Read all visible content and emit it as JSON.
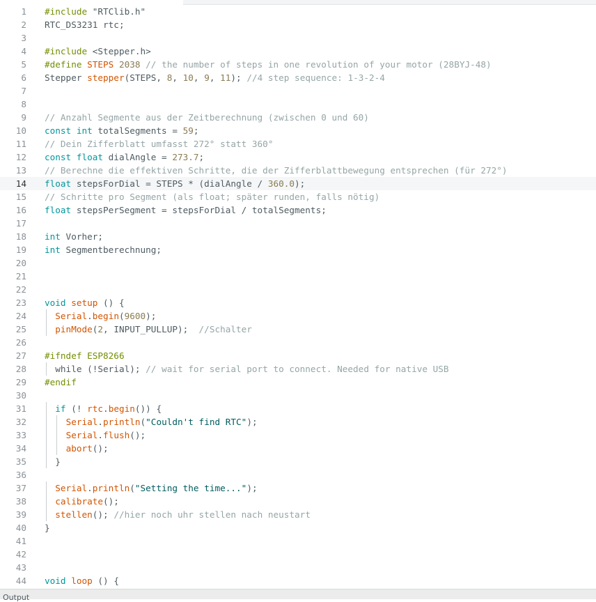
{
  "editor": {
    "current_line": 14,
    "colors": {
      "directive": "#728e00",
      "keyword": "#00979d",
      "function": "#d35400",
      "number": "#8a7b52",
      "string": "#005c5f",
      "comment": "#95a5a6",
      "text": "#4e5b61",
      "current_line_background": "#f5f6f7"
    },
    "lines": [
      {
        "n": "1",
        "tokens": [
          [
            "dir",
            "#include "
          ],
          [
            "txt",
            "\"RTClib.h\""
          ]
        ]
      },
      {
        "n": "2",
        "tokens": [
          [
            "txt",
            "RTC_DS3231 rtc;"
          ]
        ]
      },
      {
        "n": "3",
        "tokens": []
      },
      {
        "n": "4",
        "tokens": [
          [
            "dir",
            "#include "
          ],
          [
            "txt",
            "<Stepper.h>"
          ]
        ]
      },
      {
        "n": "5",
        "tokens": [
          [
            "dir",
            "#define "
          ],
          [
            "fn",
            "STEPS"
          ],
          [
            "txt",
            " "
          ],
          [
            "num",
            "2038"
          ],
          [
            "com",
            " // the number of steps in one revolution of your motor (28BYJ-48)"
          ]
        ]
      },
      {
        "n": "6",
        "tokens": [
          [
            "txt",
            "Stepper "
          ],
          [
            "fn",
            "stepper"
          ],
          [
            "txt",
            "(STEPS, "
          ],
          [
            "num",
            "8"
          ],
          [
            "txt",
            ", "
          ],
          [
            "num",
            "10"
          ],
          [
            "txt",
            ", "
          ],
          [
            "num",
            "9"
          ],
          [
            "txt",
            ", "
          ],
          [
            "num",
            "11"
          ],
          [
            "txt",
            "); "
          ],
          [
            "com",
            "//4 step sequence: 1-3-2-4"
          ]
        ]
      },
      {
        "n": "7",
        "tokens": []
      },
      {
        "n": "8",
        "tokens": []
      },
      {
        "n": "9",
        "tokens": [
          [
            "com",
            "// Anzahl Segmente aus der Zeitberechnung (zwischen 0 und 60)"
          ]
        ]
      },
      {
        "n": "10",
        "tokens": [
          [
            "kw",
            "const int"
          ],
          [
            "txt",
            " totalSegments = "
          ],
          [
            "num",
            "59"
          ],
          [
            "txt",
            ";"
          ]
        ]
      },
      {
        "n": "11",
        "tokens": [
          [
            "com",
            "// Dein Zifferblatt umfasst 272° statt 360°"
          ]
        ]
      },
      {
        "n": "12",
        "tokens": [
          [
            "kw",
            "const float"
          ],
          [
            "txt",
            " dialAngle = "
          ],
          [
            "num",
            "273.7"
          ],
          [
            "txt",
            ";"
          ]
        ]
      },
      {
        "n": "13",
        "tokens": [
          [
            "com",
            "// Berechne die effektiven Schritte, die der Zifferblattbewegung entsprechen (für 272°)"
          ]
        ]
      },
      {
        "n": "14",
        "tokens": [
          [
            "kw",
            "float"
          ],
          [
            "txt",
            " stepsForDial = STEPS * (dialAngle / "
          ],
          [
            "num",
            "360.0"
          ],
          [
            "txt",
            ");"
          ]
        ]
      },
      {
        "n": "15",
        "tokens": [
          [
            "com",
            "// Schritte pro Segment (als float; später runden, falls nötig)"
          ]
        ]
      },
      {
        "n": "16",
        "tokens": [
          [
            "kw",
            "float"
          ],
          [
            "txt",
            " stepsPerSegment = stepsForDial / totalSegments;"
          ]
        ]
      },
      {
        "n": "17",
        "tokens": []
      },
      {
        "n": "18",
        "tokens": [
          [
            "kw",
            "int"
          ],
          [
            "txt",
            " Vorher;"
          ]
        ]
      },
      {
        "n": "19",
        "tokens": [
          [
            "kw",
            "int"
          ],
          [
            "txt",
            " Segmentberechnung;"
          ]
        ]
      },
      {
        "n": "20",
        "tokens": []
      },
      {
        "n": "21",
        "tokens": []
      },
      {
        "n": "22",
        "tokens": []
      },
      {
        "n": "23",
        "tokens": [
          [
            "kw",
            "void"
          ],
          [
            "txt",
            " "
          ],
          [
            "fn",
            "setup"
          ],
          [
            "txt",
            " () {"
          ]
        ]
      },
      {
        "n": "24",
        "guides": 1,
        "tokens": [
          [
            "txt",
            "  "
          ],
          [
            "fn",
            "Serial"
          ],
          [
            "txt",
            "."
          ],
          [
            "fn",
            "begin"
          ],
          [
            "txt",
            "("
          ],
          [
            "num",
            "9600"
          ],
          [
            "txt",
            ");"
          ]
        ]
      },
      {
        "n": "25",
        "guides": 1,
        "tokens": [
          [
            "txt",
            "  "
          ],
          [
            "fn",
            "pinMode"
          ],
          [
            "txt",
            "("
          ],
          [
            "num",
            "2"
          ],
          [
            "txt",
            ", INPUT_PULLUP);  "
          ],
          [
            "com",
            "//Schalter"
          ]
        ]
      },
      {
        "n": "26",
        "tokens": []
      },
      {
        "n": "27",
        "tokens": [
          [
            "dir",
            "#ifndef ESP8266"
          ]
        ]
      },
      {
        "n": "28",
        "guides": 1,
        "tokens": [
          [
            "txt",
            "  while (!Serial); "
          ],
          [
            "com",
            "// wait for serial port to connect. Needed for native USB"
          ]
        ]
      },
      {
        "n": "29",
        "tokens": [
          [
            "dir",
            "#endif"
          ]
        ]
      },
      {
        "n": "30",
        "tokens": []
      },
      {
        "n": "31",
        "guides": 1,
        "tokens": [
          [
            "txt",
            "  "
          ],
          [
            "kw",
            "if"
          ],
          [
            "txt",
            " (! "
          ],
          [
            "fn",
            "rtc"
          ],
          [
            "txt",
            "."
          ],
          [
            "fn",
            "begin"
          ],
          [
            "txt",
            "()) {"
          ]
        ]
      },
      {
        "n": "32",
        "guides": 2,
        "tokens": [
          [
            "txt",
            "    "
          ],
          [
            "fn",
            "Serial"
          ],
          [
            "txt",
            "."
          ],
          [
            "fn",
            "println"
          ],
          [
            "txt",
            "("
          ],
          [
            "str",
            "\"Couldn't find RTC\""
          ],
          [
            "txt",
            ");"
          ]
        ]
      },
      {
        "n": "33",
        "guides": 2,
        "tokens": [
          [
            "txt",
            "    "
          ],
          [
            "fn",
            "Serial"
          ],
          [
            "txt",
            "."
          ],
          [
            "fn",
            "flush"
          ],
          [
            "txt",
            "();"
          ]
        ]
      },
      {
        "n": "34",
        "guides": 2,
        "tokens": [
          [
            "txt",
            "    "
          ],
          [
            "fn",
            "abort"
          ],
          [
            "txt",
            "();"
          ]
        ]
      },
      {
        "n": "35",
        "guides": 1,
        "tokens": [
          [
            "txt",
            "  }"
          ]
        ]
      },
      {
        "n": "36",
        "tokens": []
      },
      {
        "n": "37",
        "guides": 1,
        "tokens": [
          [
            "txt",
            "  "
          ],
          [
            "fn",
            "Serial"
          ],
          [
            "txt",
            "."
          ],
          [
            "fn",
            "println"
          ],
          [
            "txt",
            "("
          ],
          [
            "str",
            "\"Setting the time...\""
          ],
          [
            "txt",
            ");"
          ]
        ]
      },
      {
        "n": "38",
        "guides": 1,
        "tokens": [
          [
            "txt",
            "  "
          ],
          [
            "fn",
            "calibrate"
          ],
          [
            "txt",
            "();"
          ]
        ]
      },
      {
        "n": "39",
        "guides": 1,
        "tokens": [
          [
            "txt",
            "  "
          ],
          [
            "fn",
            "stellen"
          ],
          [
            "txt",
            "(); "
          ],
          [
            "com",
            "//hier noch uhr stellen nach neustart"
          ]
        ]
      },
      {
        "n": "40",
        "tokens": [
          [
            "txt",
            "}"
          ]
        ]
      },
      {
        "n": "41",
        "tokens": []
      },
      {
        "n": "42",
        "tokens": []
      },
      {
        "n": "43",
        "tokens": []
      },
      {
        "n": "44",
        "tokens": [
          [
            "kw",
            "void"
          ],
          [
            "txt",
            " "
          ],
          [
            "fn",
            "loop"
          ],
          [
            "txt",
            " () {"
          ]
        ]
      }
    ]
  },
  "bottom_panel": {
    "label": "Output"
  }
}
